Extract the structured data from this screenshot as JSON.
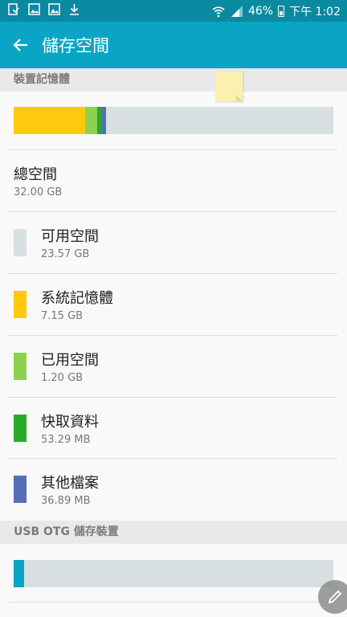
{
  "status": {
    "battery": "46%",
    "time": "下午 1:02",
    "icons": [
      "notification-icon",
      "image-icon",
      "gallery-icon",
      "download-icon",
      "wifi-icon",
      "signal-icon",
      "battery-icon"
    ]
  },
  "header": {
    "title": "儲存空間",
    "back_icon": "arrow-left-icon"
  },
  "device_storage": {
    "section_title": "裝置記憶體",
    "usage_bar": [
      {
        "name": "系統記憶體",
        "fraction": 0.223,
        "color": "#ffc90e"
      },
      {
        "name": "已用空間",
        "fraction": 0.0375,
        "color": "#8fd14f"
      },
      {
        "name": "快取資料",
        "fraction": 0.0167,
        "color": "#2aaa2a"
      },
      {
        "name": "其他檔案",
        "fraction": 0.0115,
        "color": "#5570b4"
      }
    ],
    "bar_background": "#d7dfe0",
    "total": {
      "label": "總空間",
      "value": "32.00 GB"
    },
    "items": [
      {
        "label": "可用空間",
        "value": "23.57 GB",
        "color": "#d7dfe0"
      },
      {
        "label": "系統記憶體",
        "value": "7.15 GB",
        "color": "#ffc90e"
      },
      {
        "label": "已用空間",
        "value": "1.20 GB",
        "color": "#8fd14f"
      },
      {
        "label": "快取資料",
        "value": "53.29 MB",
        "color": "#2aaa2a"
      },
      {
        "label": "其他檔案",
        "value": "36.89 MB",
        "color": "#5570b4"
      }
    ]
  },
  "usb_storage": {
    "section_title": "USB OTG 儲存裝置",
    "usage_bar": [
      {
        "name": "used",
        "fraction": 0.032,
        "color": "#0aa5c4"
      }
    ]
  },
  "fab": {
    "icon": "pencil-icon"
  },
  "colors": {
    "statusbar": "#0a8aa0",
    "appbar": "#0aa5c4",
    "background": "#f9f9f9",
    "section": "#e9e9e9"
  }
}
